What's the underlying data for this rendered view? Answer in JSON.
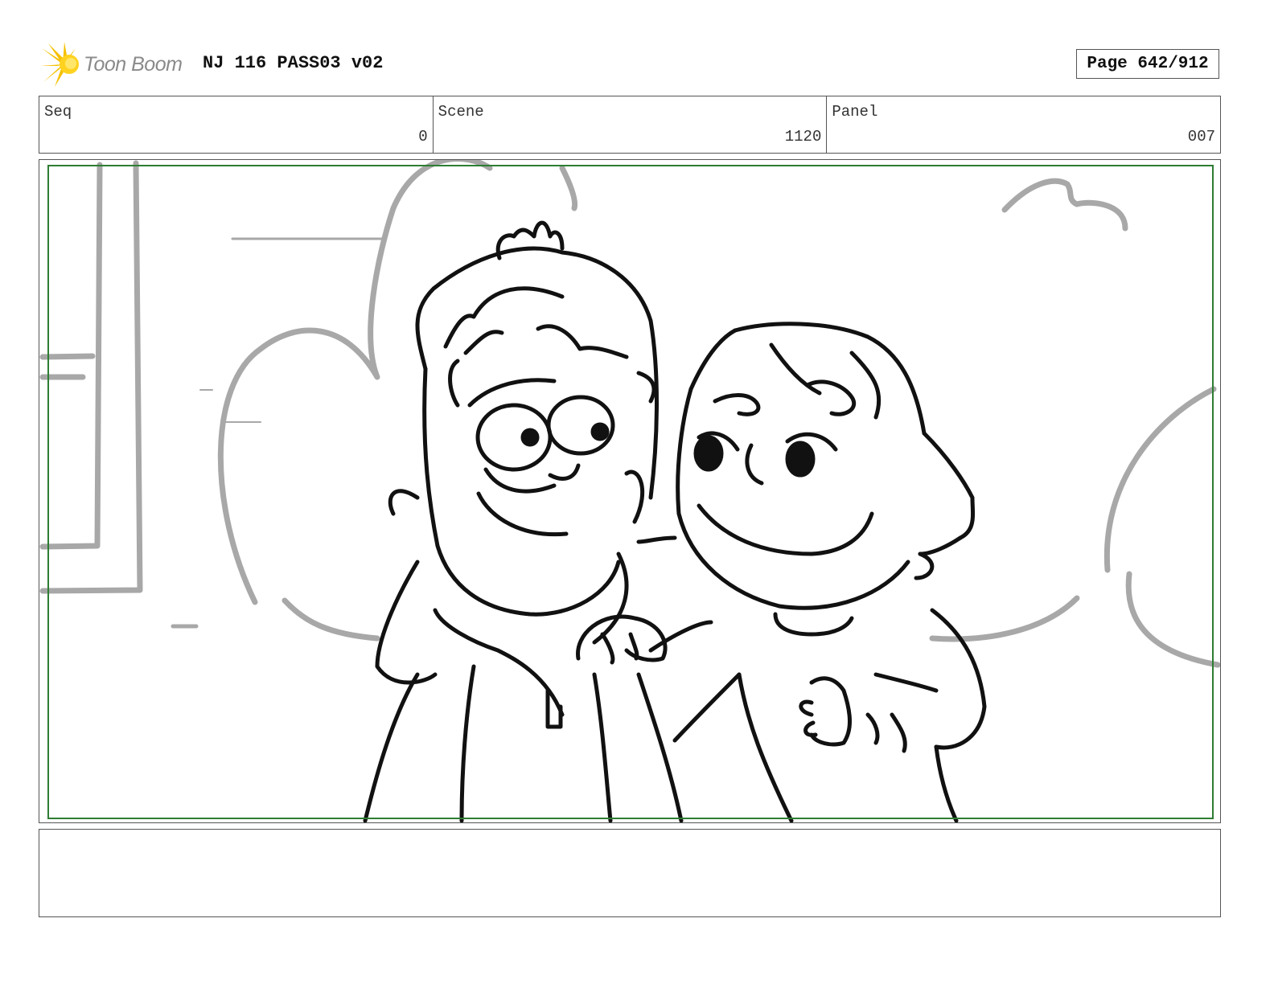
{
  "header": {
    "logo_text": "Toon Boom",
    "title": "NJ 116 PASS03 v02",
    "page": "Page 642/912"
  },
  "info": {
    "seq_label": "Seq",
    "seq_value": "0",
    "scene_label": "Scene",
    "scene_value": "1120",
    "panel_label": "Panel",
    "panel_value": "007"
  },
  "notes": {
    "text": ""
  },
  "colors": {
    "safe_frame": "#2e7d32",
    "background_sketch": "#a8a8a8",
    "character_lines": "#111111",
    "logo_burst": "#f5c000"
  }
}
